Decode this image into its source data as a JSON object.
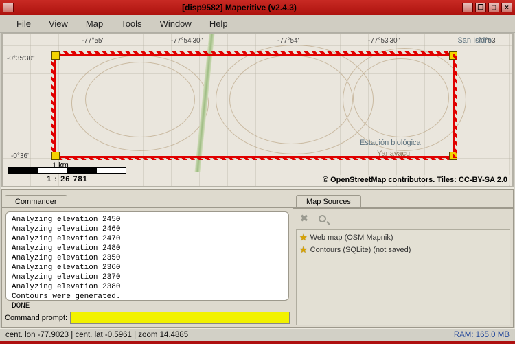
{
  "titlebar": {
    "title": "[disp9582] Maperitive (v2.4.3)"
  },
  "menubar": [
    "File",
    "View",
    "Map",
    "Tools",
    "Window",
    "Help"
  ],
  "map": {
    "ticks_x": [
      "-77°55'",
      "-77°54'30\"",
      "-77°54'",
      "-77°53'30\"",
      "-77°53'"
    ],
    "ticks_y": [
      "-0°35'30\"",
      "-0°36'"
    ],
    "places": {
      "san_isidro": "San Isidro",
      "estacion": "Estación biológica",
      "yanayacu": "Yanayacu"
    },
    "scale_km": "1 km",
    "scale_ratio": "1 : 26 781",
    "copyright": "© OpenStreetMap contributors. Tiles: CC-BY-SA 2.0"
  },
  "commander": {
    "tab": "Commander",
    "log": [
      "Analyzing elevation 2450",
      "Analyzing elevation 2460",
      "Analyzing elevation 2470",
      "Analyzing elevation 2480",
      "Analyzing elevation 2350",
      "Analyzing elevation 2360",
      "Analyzing elevation 2370",
      "Analyzing elevation 2380",
      "Contours were generated.",
      "DONE"
    ],
    "prompt_label": "Command prompt:",
    "prompt_value": ""
  },
  "sources": {
    "tab": "Map Sources",
    "items": [
      "Web map (OSM Mapnik)",
      "Contours (SQLite) (not saved)"
    ]
  },
  "statusbar": {
    "left": "cent. lon -77.9023 | cent. lat -0.5961 | zoom 14.4885",
    "right": "RAM: 165.0 MB"
  }
}
